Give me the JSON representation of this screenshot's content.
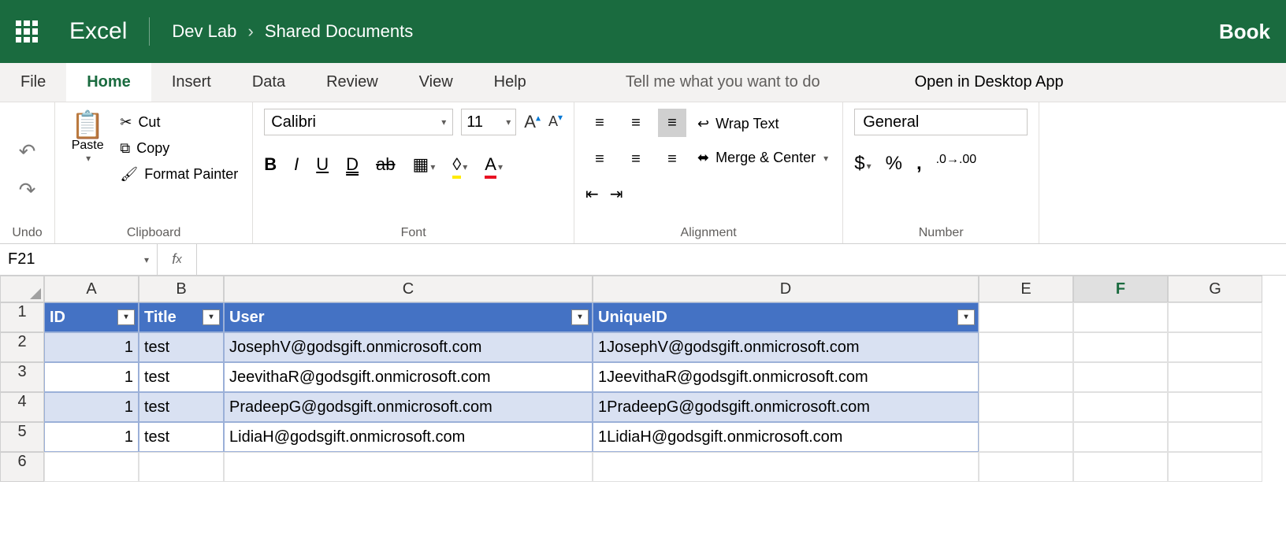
{
  "header": {
    "app": "Excel",
    "breadcrumb1": "Dev Lab",
    "breadcrumb2": "Shared Documents",
    "docname": "Book"
  },
  "tabs": {
    "file": "File",
    "home": "Home",
    "insert": "Insert",
    "data": "Data",
    "review": "Review",
    "view": "View",
    "help": "Help",
    "tellme": "Tell me what you want to do",
    "open_desktop": "Open in Desktop App"
  },
  "ribbon": {
    "undo_label": "Undo",
    "paste": "Paste",
    "cut": "Cut",
    "copy": "Copy",
    "format_painter": "Format Painter",
    "clipboard_label": "Clipboard",
    "font_name": "Calibri",
    "font_size": "11",
    "font_label": "Font",
    "wrap_text": "Wrap Text",
    "merge_center": "Merge & Center",
    "alignment_label": "Alignment",
    "number_format": "General",
    "number_label": "Number"
  },
  "namebox": "F21",
  "formula": "",
  "columns": [
    "A",
    "B",
    "C",
    "D",
    "E",
    "F",
    "G"
  ],
  "selected_col": "F",
  "table": {
    "headers": {
      "a": "ID",
      "b": "Title",
      "c": "User",
      "d": "UniqueID"
    },
    "rows": [
      {
        "id": "1",
        "title": "test",
        "user": "JosephV@godsgift.onmicrosoft.com",
        "uid": "1JosephV@godsgift.onmicrosoft.com"
      },
      {
        "id": "1",
        "title": "test",
        "user": "JeevithaR@godsgift.onmicrosoft.com",
        "uid": "1JeevithaR@godsgift.onmicrosoft.com"
      },
      {
        "id": "1",
        "title": "test",
        "user": "PradeepG@godsgift.onmicrosoft.com",
        "uid": "1PradeepG@godsgift.onmicrosoft.com"
      },
      {
        "id": "1",
        "title": "test",
        "user": "LidiaH@godsgift.onmicrosoft.com",
        "uid": "1LidiaH@godsgift.onmicrosoft.com"
      }
    ]
  },
  "rownums": [
    "1",
    "2",
    "3",
    "4",
    "5",
    "6"
  ]
}
